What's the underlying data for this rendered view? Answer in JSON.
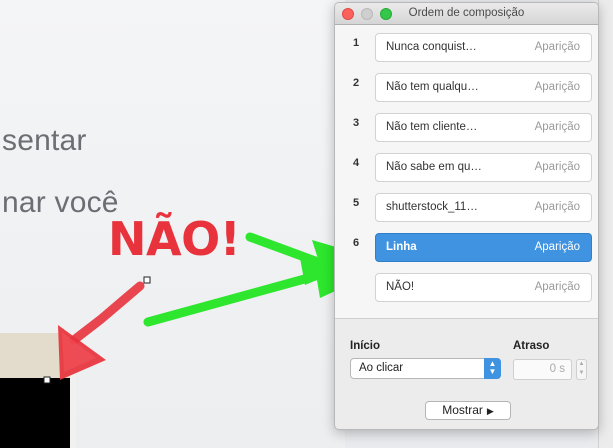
{
  "slide": {
    "line1": "sentar",
    "line2": "nar você",
    "annotation": "NÃO!"
  },
  "panel": {
    "title": "Ordem de composição",
    "items": [
      {
        "num": "1",
        "name": "Nunca conquist…",
        "kind": "Aparição"
      },
      {
        "num": "2",
        "name": "Não tem qualqu…",
        "kind": "Aparição"
      },
      {
        "num": "3",
        "name": "Não tem cliente…",
        "kind": "Aparição"
      },
      {
        "num": "4",
        "name": "Não sabe em qu…",
        "kind": "Aparição"
      },
      {
        "num": "5",
        "name": "shutterstock_11…",
        "kind": "Aparição"
      },
      {
        "num": "6",
        "name": "Linha",
        "kind": "Aparição",
        "selected": true
      },
      {
        "num": "",
        "name": "NÃO!",
        "kind": "Aparição"
      }
    ],
    "start_label": "Início",
    "start_value": "Ao clicar",
    "delay_label": "Atraso",
    "delay_value": "0 s",
    "show_button": "Mostrar",
    "show_icon": "play-icon"
  },
  "colors": {
    "selection": "#3f93e0",
    "annotation_red": "#e8323c",
    "arrow_green": "#2de62d"
  }
}
